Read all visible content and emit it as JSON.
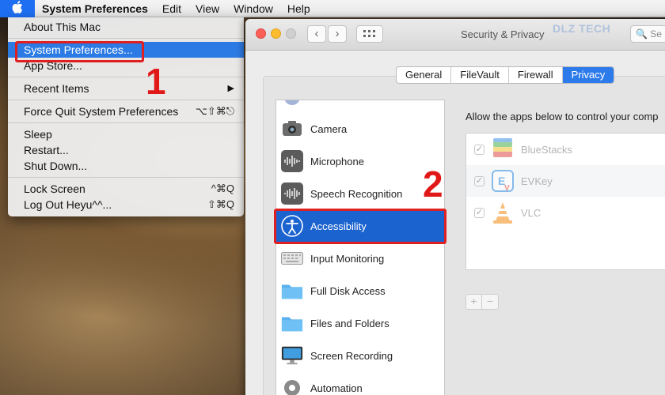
{
  "menubar": {
    "app_name": "System Preferences",
    "items": [
      "Edit",
      "View",
      "Window",
      "Help"
    ]
  },
  "apple_menu": {
    "about": "About This Mac",
    "system_preferences": "System Preferences...",
    "app_store": "App Store...",
    "recent_items": "Recent Items",
    "force_quit": "Force Quit System Preferences",
    "force_quit_shortcut": "⌥⇧⌘⎋",
    "sleep": "Sleep",
    "restart": "Restart...",
    "shut_down": "Shut Down...",
    "lock_screen": "Lock Screen",
    "lock_screen_shortcut": "^⌘Q",
    "log_out": "Log Out Heyu^^...",
    "log_out_shortcut": "⇧⌘Q"
  },
  "callouts": {
    "step1": "1",
    "step2": "2"
  },
  "window": {
    "title": "Security & Privacy",
    "watermark": "DLZ TECH",
    "search_placeholder": "Se"
  },
  "tabs": [
    {
      "label": "General"
    },
    {
      "label": "FileVault"
    },
    {
      "label": "Firewall"
    },
    {
      "label": "Privacy",
      "active": true
    }
  ],
  "sidebar": {
    "items": [
      {
        "label": "Camera",
        "icon": "camera-icon"
      },
      {
        "label": "Microphone",
        "icon": "microphone-icon"
      },
      {
        "label": "Speech Recognition",
        "icon": "speech-recognition-icon"
      },
      {
        "label": "Accessibility",
        "icon": "accessibility-icon",
        "selected": true
      },
      {
        "label": "Input Monitoring",
        "icon": "keyboard-icon"
      },
      {
        "label": "Full Disk Access",
        "icon": "folder-icon"
      },
      {
        "label": "Files and Folders",
        "icon": "folder-icon"
      },
      {
        "label": "Screen Recording",
        "icon": "monitor-icon"
      },
      {
        "label": "Automation",
        "icon": "gear-icon"
      }
    ]
  },
  "right_panel": {
    "description": "Allow the apps below to control your comp",
    "apps": [
      {
        "name": "BlueStacks",
        "checked": true,
        "icon": "bluestacks-icon"
      },
      {
        "name": "EVKey",
        "checked": true,
        "icon": "evkey-icon"
      },
      {
        "name": "VLC",
        "checked": true,
        "icon": "vlc-icon"
      }
    ],
    "add_label": "+",
    "remove_label": "−"
  },
  "colors": {
    "highlight": "#2c7be5",
    "callout": "#e02020",
    "selected_row": "#1b63cf"
  }
}
